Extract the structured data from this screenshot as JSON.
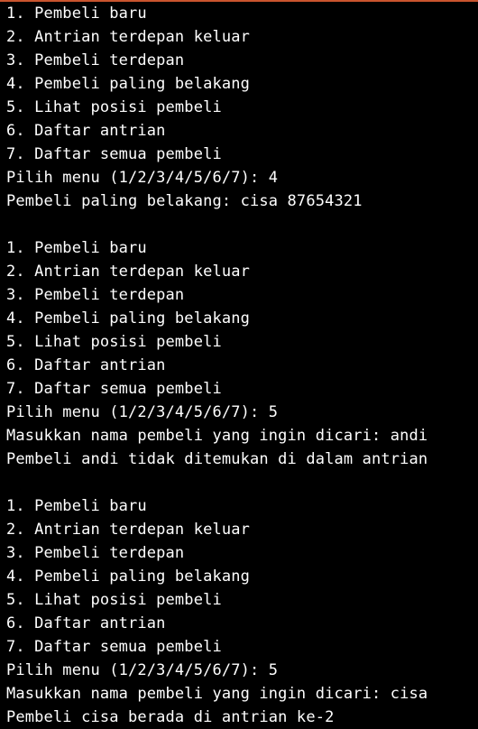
{
  "theme": {
    "background": "#000000",
    "text": "#ffffff",
    "accent": "#c9542e"
  },
  "terminal": {
    "lines": [
      "1. Pembeli baru",
      "2. Antrian terdepan keluar",
      "3. Pembeli terdepan",
      "4. Pembeli paling belakang",
      "5. Lihat posisi pembeli",
      "6. Daftar antrian",
      "7. Daftar semua pembeli",
      "Pilih menu (1/2/3/4/5/6/7): 4",
      "Pembeli paling belakang: cisa 87654321",
      "",
      "1. Pembeli baru",
      "2. Antrian terdepan keluar",
      "3. Pembeli terdepan",
      "4. Pembeli paling belakang",
      "5. Lihat posisi pembeli",
      "6. Daftar antrian",
      "7. Daftar semua pembeli",
      "Pilih menu (1/2/3/4/5/6/7): 5",
      "Masukkan nama pembeli yang ingin dicari: andi",
      "Pembeli andi tidak ditemukan di dalam antrian",
      "",
      "1. Pembeli baru",
      "2. Antrian terdepan keluar",
      "3. Pembeli terdepan",
      "4. Pembeli paling belakang",
      "5. Lihat posisi pembeli",
      "6. Daftar antrian",
      "7. Daftar semua pembeli",
      "Pilih menu (1/2/3/4/5/6/7): 5",
      "Masukkan nama pembeli yang ingin dicari: cisa",
      "Pembeli cisa berada di antrian ke-2"
    ]
  }
}
